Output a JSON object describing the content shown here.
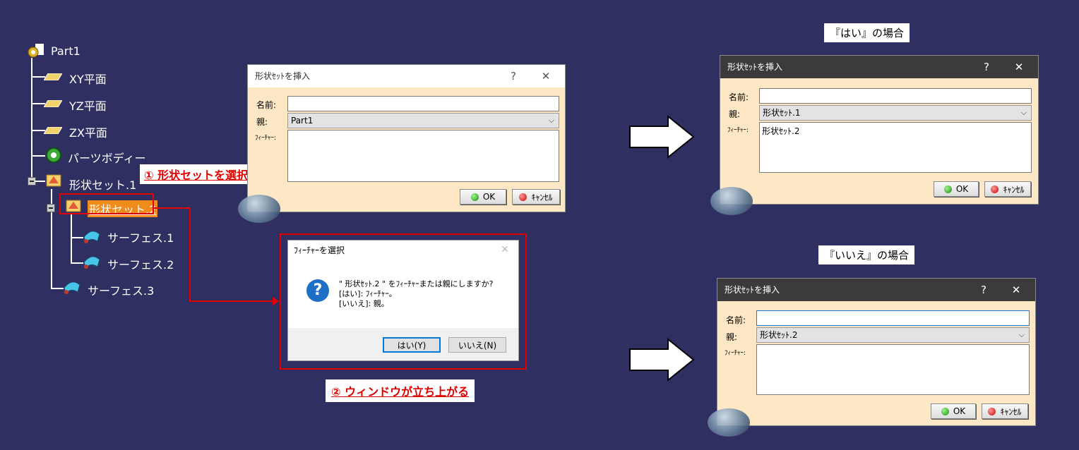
{
  "tree": {
    "root": "Part1",
    "xy_plane": "XY平面",
    "yz_plane": "YZ平面",
    "zx_plane": "ZX平面",
    "body": "パーツボディー",
    "gs1": "形状セット.1",
    "gs2": "形状セット.2",
    "surf1": "サーフェス.1",
    "surf2": "サーフェス.2",
    "surf3": "サーフェス.3"
  },
  "callouts": {
    "step1": "① 形状セットを選択",
    "step2": "② ウィンドウが立ち上がる",
    "case_yes": "『はい』の場合",
    "case_no": "『いいえ』の場合"
  },
  "dialog_main": {
    "title": "形状ｾｯﾄを挿入",
    "help": "?",
    "close": "✕",
    "name_label": "名前:",
    "name_value": "",
    "parent_label": "親:",
    "parent_value": "Part1",
    "feature_label": "ﾌｨｰﾁｬｰ:",
    "feature_value": "",
    "ok": "OK",
    "cancel": "ｷｬﾝｾﾙ"
  },
  "dialog_yes": {
    "title": "形状ｾｯﾄを挿入",
    "help": "?",
    "close": "✕",
    "name_label": "名前:",
    "name_value": "",
    "parent_label": "親:",
    "parent_value": "形状ｾｯﾄ.1",
    "feature_label": "ﾌｨｰﾁｬｰ:",
    "feature_value": "形状ｾｯﾄ.2",
    "ok": "OK",
    "cancel": "ｷｬﾝｾﾙ"
  },
  "dialog_no": {
    "title": "形状ｾｯﾄを挿入",
    "help": "?",
    "close": "✕",
    "name_label": "名前:",
    "name_value": "",
    "parent_label": "親:",
    "parent_value": "形状ｾｯﾄ.2",
    "feature_label": "ﾌｨｰﾁｬｰ:",
    "feature_value": "",
    "ok": "OK",
    "cancel": "ｷｬﾝｾﾙ"
  },
  "msgbox": {
    "title": "ﾌｨｰﾁｬｰを選択",
    "close": "✕",
    "line1": "\" 形状ｾｯﾄ.2 \" をﾌｨｰﾁｬｰまたは親にしますか?",
    "line2": "[はい]: ﾌｨｰﾁｬｰ。",
    "line3": "[いいえ]: 親。",
    "yes": "はい(Y)",
    "no": "いいえ(N)"
  },
  "colors": {
    "background": "#2f3061",
    "dialog_body": "#fde7c5",
    "highlight": "#e00000",
    "selection": "#f08c1c"
  }
}
